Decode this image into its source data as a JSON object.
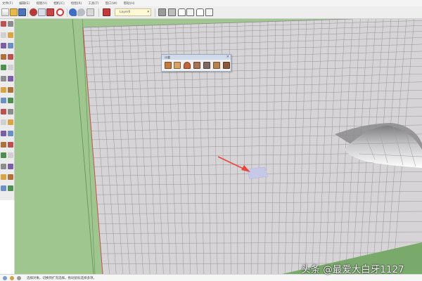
{
  "menu": [
    "文件(F)",
    "编辑(E)",
    "视图(V)",
    "相机(C)",
    "绘图(R)",
    "工具(T)",
    "窗口(W)",
    "帮助(H)"
  ],
  "toolbar": {
    "icons": [
      "new-file-icon",
      "open-file-icon",
      "save-icon",
      "cut-icon",
      "copy-icon",
      "paste-icon",
      "erase-icon",
      "undo-icon",
      "redo-icon",
      "print-icon",
      "model-info-icon"
    ],
    "layer_value": "Layer0",
    "view_icons": [
      "iso-view-icon",
      "top-view-icon",
      "front-view-icon",
      "right-view-icon",
      "back-view-icon",
      "left-view-icon"
    ]
  },
  "floating_toolbar": {
    "title": "沙盒",
    "icons": [
      "sandbox-from-contours-icon",
      "sandbox-from-scratch-icon",
      "smoove-icon",
      "stamp-icon",
      "drape-icon",
      "add-detail-icon",
      "flip-edge-icon"
    ]
  },
  "palette_icons": [
    "select-icon",
    "make-component-icon",
    "eraser-icon",
    "paint-bucket-icon",
    "line-icon",
    "arc-icon",
    "freehand-icon",
    "rectangle-icon",
    "circle-icon",
    "polygon-icon",
    "move-icon",
    "push-pull-icon",
    "rotate-icon",
    "follow-me-icon",
    "scale-icon",
    "offset-icon",
    "tape-measure-icon",
    "dimension-icon",
    "protractor-icon",
    "text-icon",
    "axes-icon",
    "3d-text-icon",
    "orbit-icon",
    "pan-icon",
    "zoom-icon",
    "zoom-window-icon",
    "zoom-extents-icon",
    "previous-view-icon",
    "walk-icon",
    "look-around-icon",
    "position-camera-icon",
    "section-plane-icon"
  ],
  "status": {
    "text": "选择对象。切换到扩充选择。拖动鼠标选择多项。"
  },
  "colors": {
    "ground": "#9fc68f",
    "grid_fill": "#d6d4d6",
    "grid_line": "#8f8f8f",
    "selected_tile": "#c5c8e6",
    "arrow": "#e8453c"
  },
  "watermark": "头条 @最爱大白牙1127"
}
